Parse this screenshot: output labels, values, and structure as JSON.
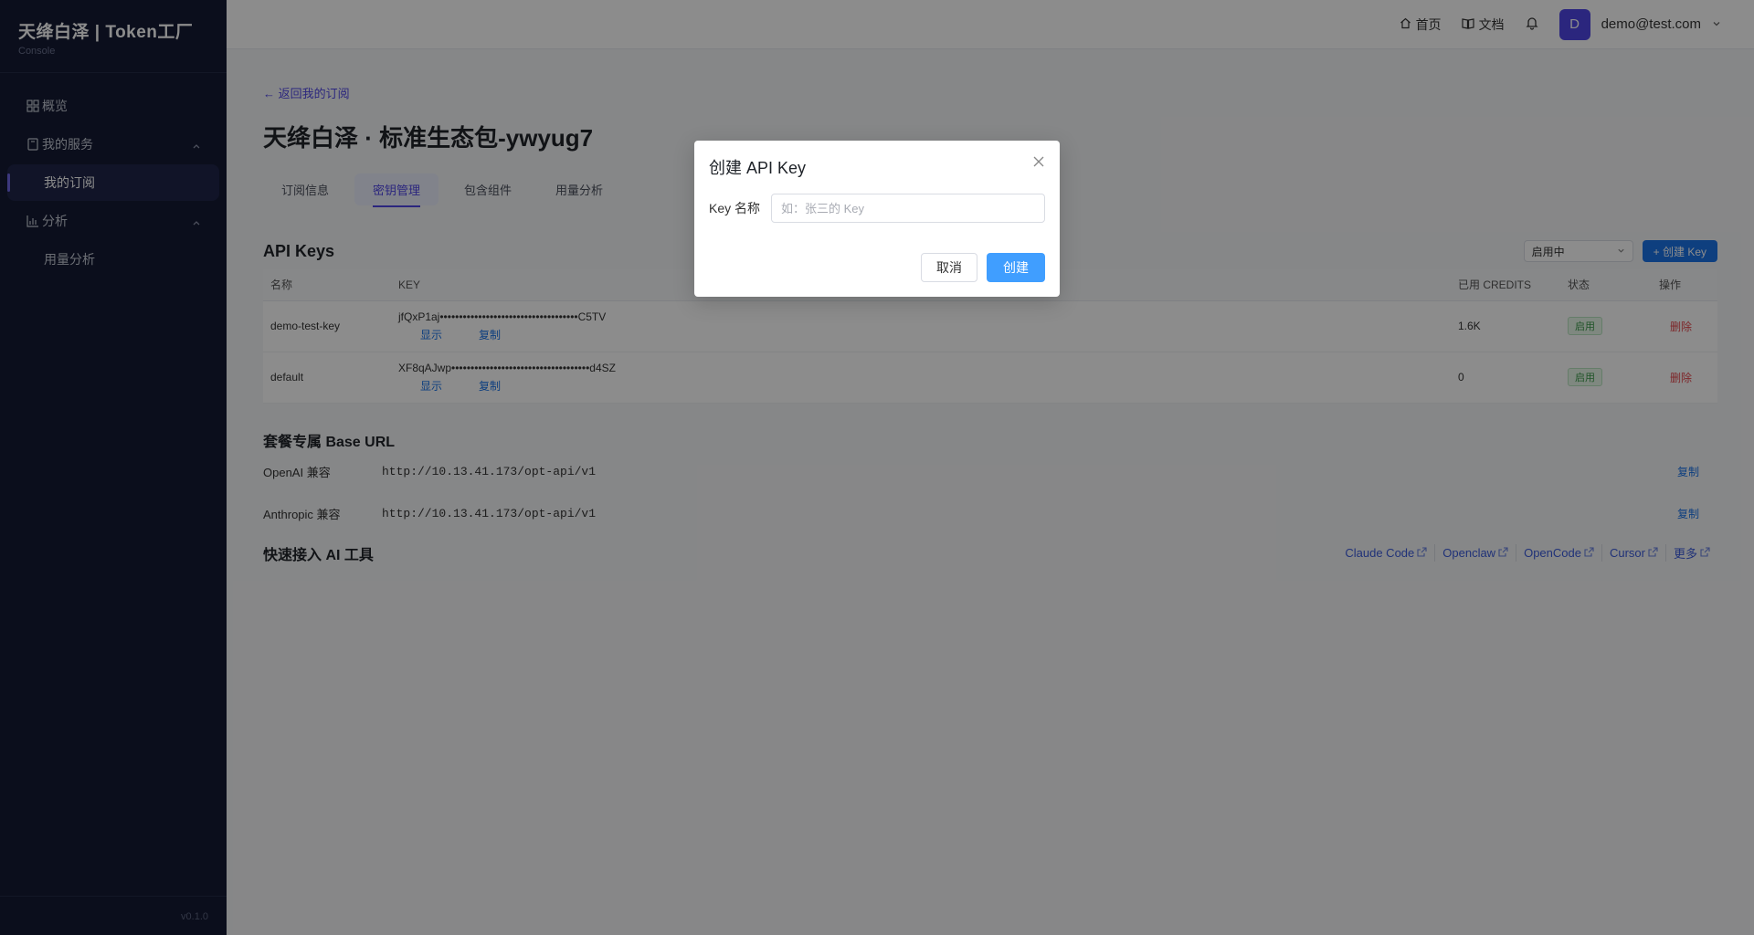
{
  "brand": {
    "title": "天绛白泽 | Token工厂",
    "subtitle": "Console"
  },
  "sidebar": {
    "items": [
      {
        "label": "概览",
        "icon": "dashboard-icon"
      },
      {
        "label": "我的服务",
        "icon": "book-icon"
      },
      {
        "label": "我的订阅",
        "active": true
      },
      {
        "label": "分析",
        "icon": "bar-chart-icon"
      },
      {
        "label": "用量分析"
      }
    ],
    "version": "v0.1.0"
  },
  "header": {
    "home": "首页",
    "docs": "文档",
    "avatar_letter": "D",
    "user_email": "demo@test.com"
  },
  "main": {
    "back_link": "← 返回我的订阅",
    "title": "天绛白泽 · 标准生态包-ywyug7",
    "tabs": [
      "订阅信息",
      "密钥管理",
      "包含组件",
      "用量分析"
    ],
    "active_tab": "密钥管理",
    "keys": {
      "title": "API Keys",
      "filter_value": "启用中",
      "create_button": "+ 创建 Key",
      "columns": [
        "名称",
        "KEY",
        "已用 CREDITS",
        "状态",
        "操作"
      ],
      "rows": [
        {
          "name": "demo-test-key",
          "key": "jfQxP1aj••••••••••••••••••••••••••••••••••••C5TV",
          "show": "显示",
          "copy": "复制",
          "credits": "1.6K",
          "status": "启用",
          "action": "删除"
        },
        {
          "name": "default",
          "key": "XF8qAJwp••••••••••••••••••••••••••••••••••••d4SZ",
          "show": "显示",
          "copy": "复制",
          "credits": "0",
          "status": "启用",
          "action": "删除"
        }
      ]
    },
    "base_url": {
      "title": "套餐专属 Base URL",
      "rows": [
        {
          "label": "OpenAI 兼容",
          "url": "http://10.13.41.173/opt-api/v1",
          "copy": "复制"
        },
        {
          "label": "Anthropic 兼容",
          "url": "http://10.13.41.173/opt-api/v1",
          "copy": "复制"
        }
      ]
    },
    "tools": {
      "title": "快速接入 AI 工具",
      "links": [
        "Claude Code",
        "Openclaw",
        "OpenCode",
        "Cursor",
        "更多"
      ]
    }
  },
  "modal": {
    "title": "创建 API Key",
    "field_label": "Key 名称",
    "placeholder": "如：张三的 Key",
    "cancel": "取消",
    "create": "创建"
  }
}
